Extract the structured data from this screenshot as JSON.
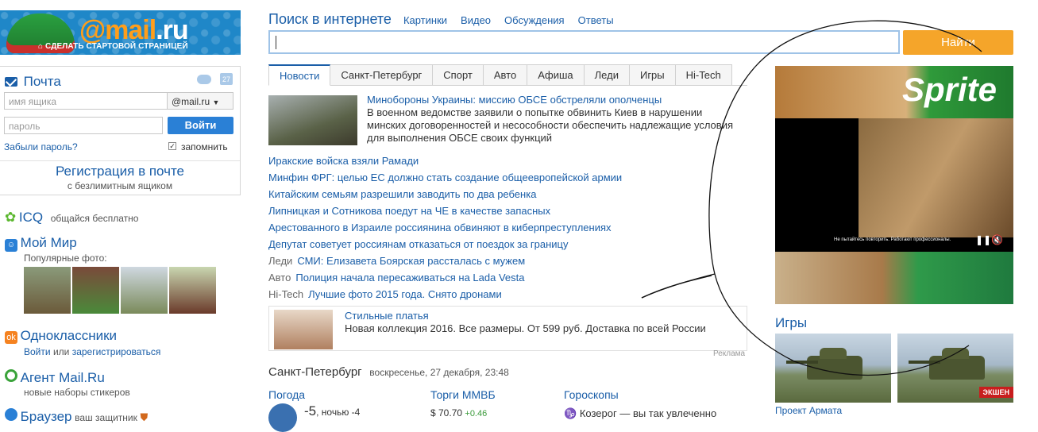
{
  "logo": {
    "brand_main": "@mail",
    "brand_dot": ".ru",
    "startpage_label": "СДЕЛАТЬ СТАРТОВОЙ СТРАНИЦЕЙ"
  },
  "mail": {
    "title": "Почта",
    "calendar_day": "27",
    "username_placeholder": "имя ящика",
    "domain_selected": "@mail.ru",
    "password_placeholder": "пароль",
    "login_button": "Войти",
    "forgot_link": "Забыли пароль?",
    "remember_label": "запомнить",
    "register_title": "Регистрация в почте",
    "register_sub": "с безлимитным ящиком"
  },
  "services": {
    "icq": {
      "title": "ICQ",
      "sub": "общайся бесплатно"
    },
    "moimir": {
      "title": "Мой Мир",
      "sub": "Популярные фото:"
    },
    "ok": {
      "title": "Одноклассники",
      "login": "Войти",
      "or": "или",
      "register": "зарегистрироваться"
    },
    "agent": {
      "title": "Агент Mail.Ru",
      "sub": "новые наборы стикеров"
    },
    "browser": {
      "title": "Браузер",
      "sub": "ваш защитник"
    }
  },
  "search": {
    "title": "Поиск в интернете",
    "links": [
      "Картинки",
      "Видео",
      "Обсуждения",
      "Ответы"
    ],
    "button": "Найти"
  },
  "tabs": [
    "Новости",
    "Санкт-Петербург",
    "Спорт",
    "Авто",
    "Афиша",
    "Леди",
    "Игры",
    "Hi-Tech"
  ],
  "news": {
    "lead_title": "Минобороны Украины: миссию ОБСЕ обстреляли ополченцы",
    "lead_text": "В военном ведомстве заявили о попытке обвинить Киев в нарушении минских договоренностей и несособности обеспечить надлежащие условия для выполнения ОБСЕ своих функций",
    "items": [
      {
        "cat": "",
        "text": "Иракские войска взяли Рамади"
      },
      {
        "cat": "",
        "text": "Минфин ФРГ: целью ЕС должно стать создание общеевропейской армии"
      },
      {
        "cat": "",
        "text": "Китайским семьям разрешили заводить по два ребенка"
      },
      {
        "cat": "",
        "text": "Липницкая и Сотникова поедут на ЧЕ в качестве запасных"
      },
      {
        "cat": "",
        "text": "Арестованного в Израиле россиянина обвиняют в киберпреступлениях"
      },
      {
        "cat": "",
        "text": "Депутат советует россиянам отказаться от поездок за границу"
      },
      {
        "cat": "Леди",
        "text": "СМИ: Елизавета Боярская рассталась с мужем"
      },
      {
        "cat": "Авто",
        "text": "Полиция начала пересаживаться на Lada Vesta"
      },
      {
        "cat": "Hi-Tech",
        "text": "Лучшие фото 2015 года. Снято дронами"
      }
    ]
  },
  "ad": {
    "title": "Стильные платья",
    "text": "Новая коллекция 2016. Все размеры. От 599 руб. Доставка по всей России",
    "label": "Реклама"
  },
  "city": {
    "name": "Санкт-Петербург",
    "date": "воскресенье, 27 декабря, 23:48"
  },
  "weather": {
    "title": "Погода",
    "temp": "-5",
    "night": ", ночью -4"
  },
  "stocks": {
    "title": "Торги ММВБ",
    "usd": "$ 70.70",
    "usd_change": "+0.46"
  },
  "horo": {
    "title": "Гороскопы",
    "text": "Козерог — вы так увлеченно"
  },
  "banner": {
    "brand": "Sprite",
    "subtitle": "Не пытайтесь повторить. Работают профессионалы."
  },
  "games": {
    "title": "Игры",
    "game1": "Проект Армата",
    "badge": "ЭКШЕН"
  }
}
